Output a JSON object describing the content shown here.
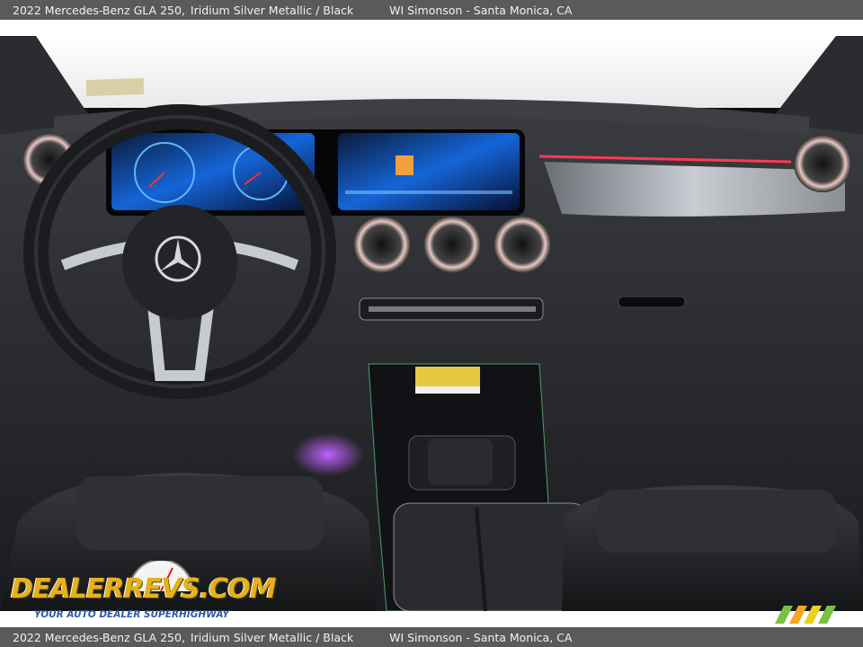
{
  "caption": {
    "vehicle": "2022 Mercedes-Benz GLA 250,",
    "color": "Iridium Silver Metallic / Black",
    "dealer": "WI Simonson - Santa Monica, CA"
  },
  "photo": {
    "subject": "dashboard-interior",
    "steering_wheel_emblem": "mercedes-star-icon"
  },
  "watermark": {
    "logo": "DEALERREVS.COM",
    "tagline": "YOUR AUTO DEALER SUPERHIGHWAY"
  },
  "colors": {
    "caption_bg": "#5a5a5a",
    "caption_text": "#f2f2f2",
    "ambient_light": "#ff3a50",
    "screen_blue": "#2a8cff",
    "logo_yellow": "#e6b21a",
    "tagline_blue": "#2d5aa0"
  }
}
